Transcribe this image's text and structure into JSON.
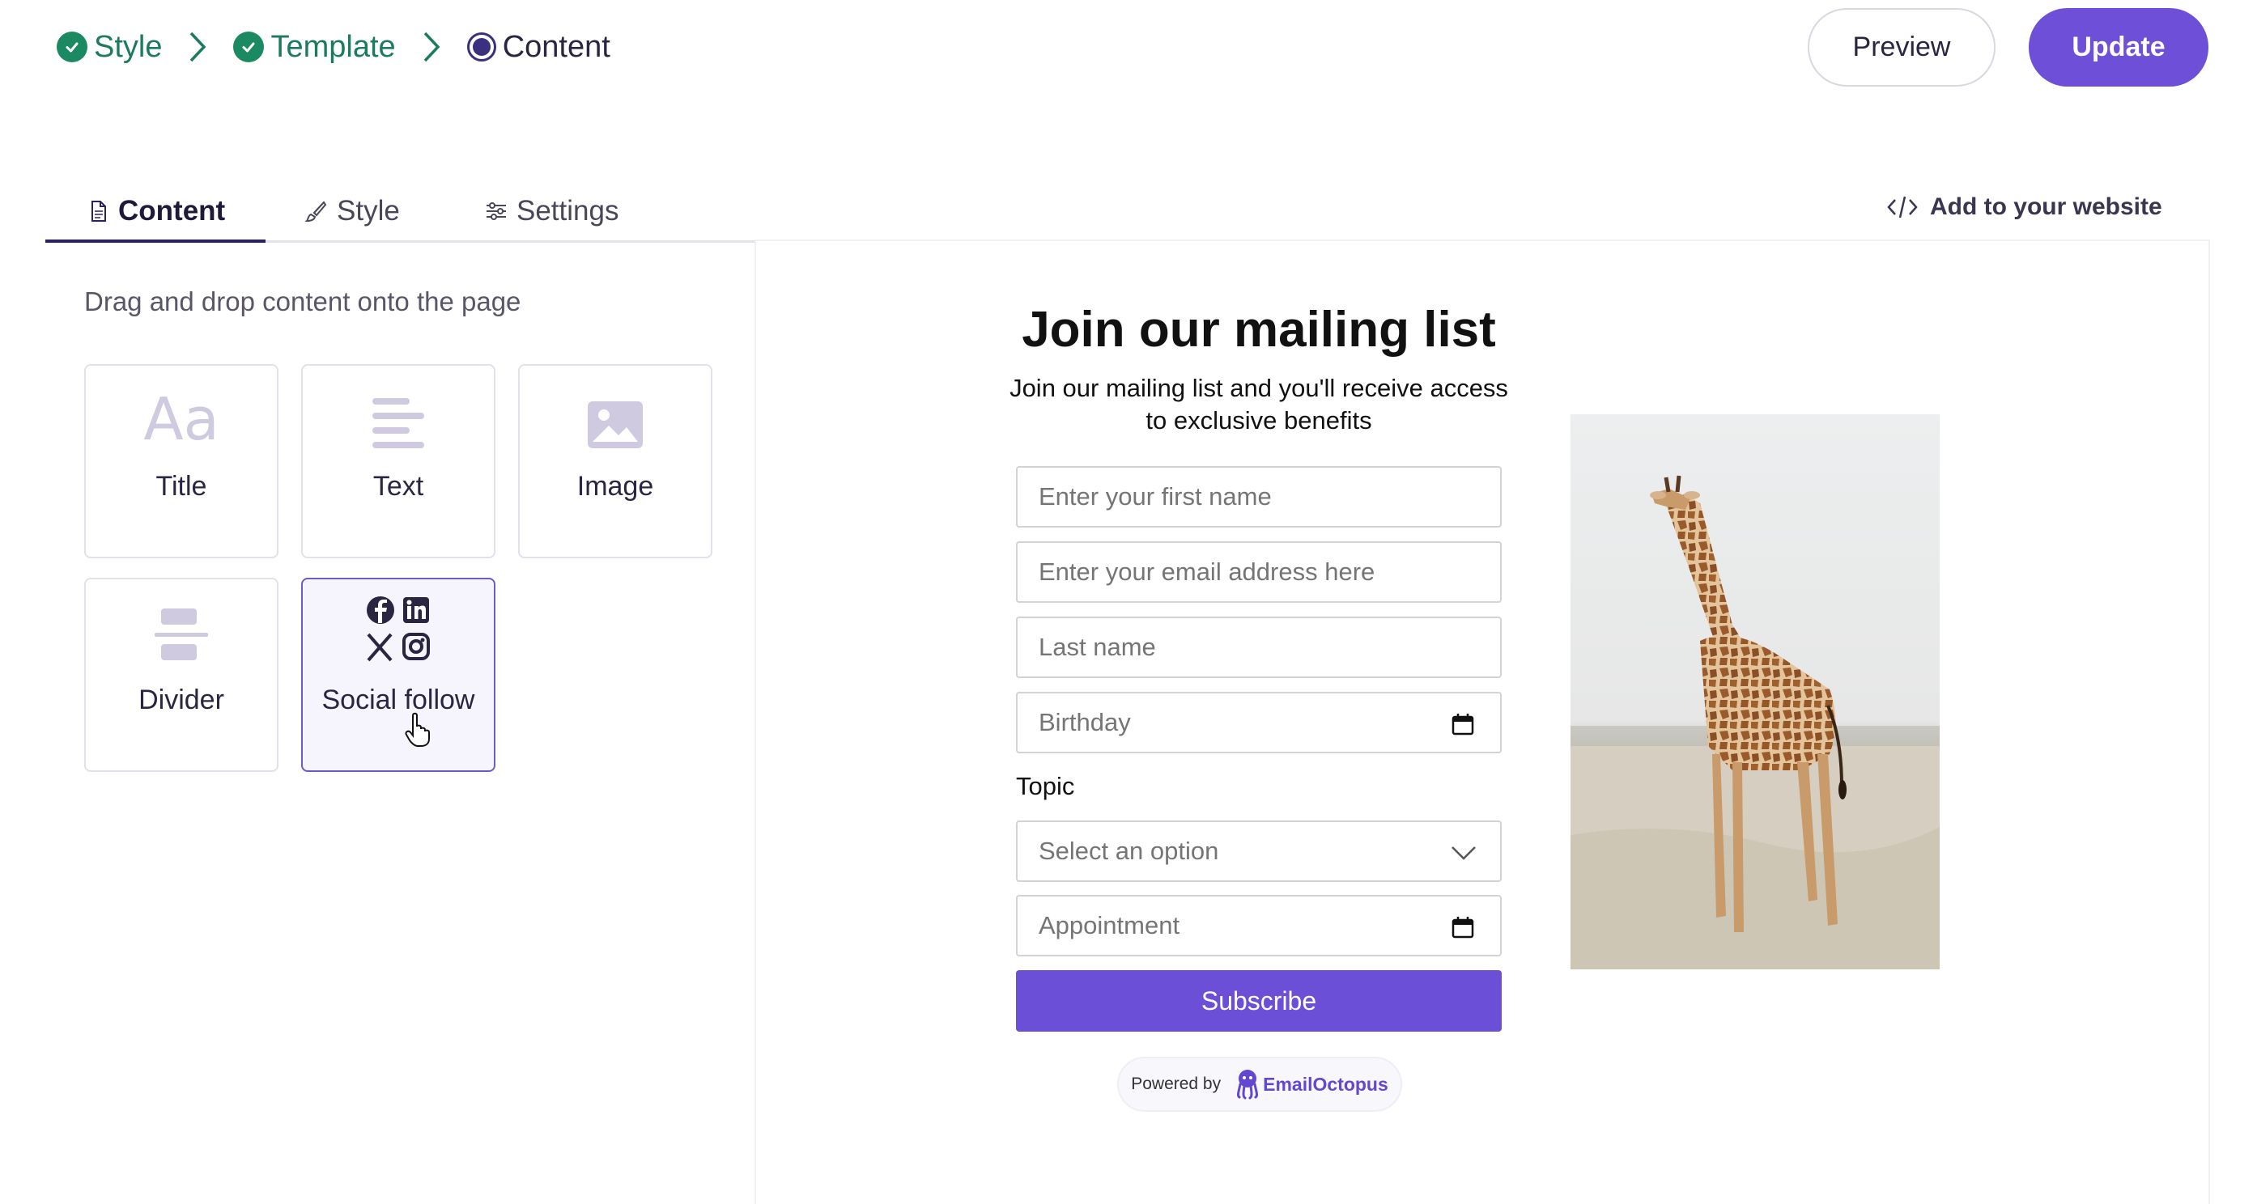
{
  "breadcrumb": {
    "steps": [
      {
        "label": "Style",
        "state": "done"
      },
      {
        "label": "Template",
        "state": "done"
      },
      {
        "label": "Content",
        "state": "current"
      }
    ]
  },
  "header": {
    "preview_label": "Preview",
    "update_label": "Update"
  },
  "tabs": [
    {
      "label": "Content",
      "icon": "document-icon",
      "active": true
    },
    {
      "label": "Style",
      "icon": "brush-icon",
      "active": false
    },
    {
      "label": "Settings",
      "icon": "sliders-icon",
      "active": false
    }
  ],
  "add_to_website": {
    "label": "Add to your website",
    "icon": "code-icon"
  },
  "panel": {
    "hint": "Drag and drop content onto the page",
    "blocks": [
      {
        "label": "Title",
        "icon": "title-aa-icon"
      },
      {
        "label": "Text",
        "icon": "text-lines-icon"
      },
      {
        "label": "Image",
        "icon": "image-icon"
      },
      {
        "label": "Divider",
        "icon": "divider-icon"
      },
      {
        "label": "Social follow",
        "icon": "social-icons-icon"
      }
    ]
  },
  "form": {
    "title": "Join our mailing list",
    "subtitle": "Join our mailing list and you'll receive access to exclusive benefits",
    "first_name_placeholder": "Enter your first name",
    "email_placeholder": "Enter your email address here",
    "last_name_placeholder": "Last name",
    "birthday_placeholder": "Birthday",
    "topic_label": "Topic",
    "topic_select": "Select an option",
    "appointment_placeholder": "Appointment",
    "subscribe_label": "Subscribe",
    "powered_by": "Powered by",
    "brand": "EmailOctopus"
  },
  "colors": {
    "accent": "#6d4fd8",
    "done_green": "#1b8a63",
    "text_dark": "#2a2540"
  }
}
